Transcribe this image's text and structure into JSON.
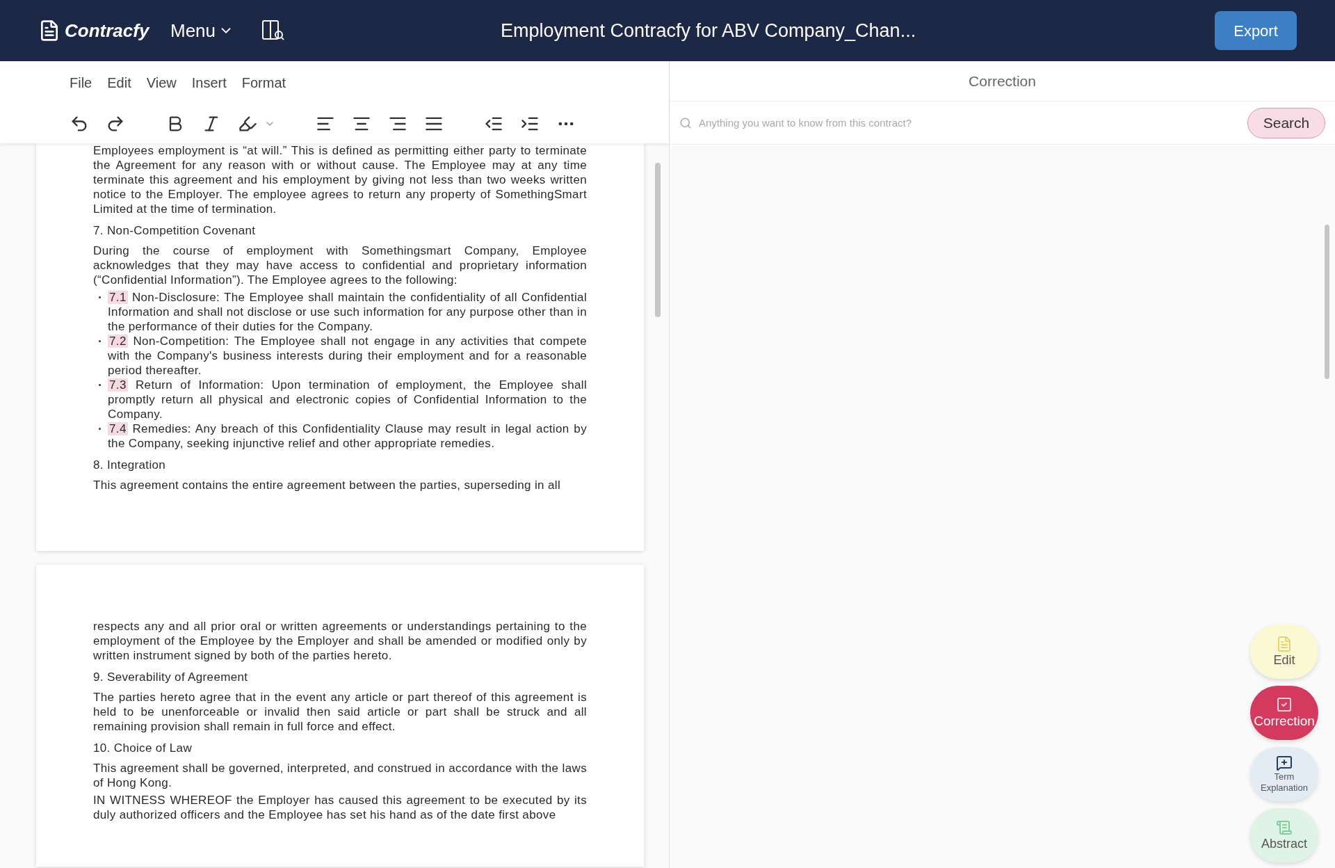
{
  "header": {
    "logo": "Contracfy",
    "menu": "Menu",
    "title": "Employment Contracfy for ABV Company_Chan...",
    "export": "Export"
  },
  "menu_bar": [
    "File",
    "Edit",
    "View",
    "Insert",
    "Format"
  ],
  "pages": [
    {
      "blocks": [
        {
          "kind": "paragraph",
          "text": "Employees employment is “at will.” This is defined as permitting either party to terminate the Agreement for any reason with or without cause. The Employee may at any time terminate this agreement and his employment by giving not less than two weeks written notice to the Employer. The employee agrees to return any property of SomethingSmart Limited at the time of termination."
        },
        {
          "kind": "heading",
          "text": "7. Non-Competition Covenant"
        },
        {
          "kind": "paragraph",
          "text": "During the course of employment with Somethingsmart Company, Employee acknowledges that they may have access to confidential and proprietary information (“Confidential Information”). The Employee agrees to the following:"
        },
        {
          "kind": "bullet",
          "number": "7.1",
          "text": "Non-Disclosure: The Employee shall maintain the confidentiality of all Confidential Information and shall not disclose or use such information for any purpose other than in the performance of their duties for the Company."
        },
        {
          "kind": "bullet",
          "number": "7.2",
          "text": "Non-Competition: The Employee shall not engage in any activities that compete with the Company's business interests during their employment and for a reasonable period thereafter."
        },
        {
          "kind": "bullet",
          "number": "7.3",
          "text": "Return of Information: Upon termination of employment, the Employee shall promptly return all physical and electronic copies of Confidential Information to the Company."
        },
        {
          "kind": "bullet",
          "number": "7.4",
          "text": "Remedies: Any breach of this Confidentiality Clause may result in legal action by the Company, seeking injunctive relief and other appropriate remedies."
        },
        {
          "kind": "heading",
          "text": "8. Integration"
        },
        {
          "kind": "paragraph",
          "text": "This agreement contains the entire agreement between the parties, superseding in all"
        }
      ]
    },
    {
      "blocks": [
        {
          "kind": "paragraph",
          "text": "respects any and all prior oral or written agreements or understandings pertaining to the employment of the Employee by the Employer and shall be amended or modified only by written instrument signed by both of the parties hereto."
        },
        {
          "kind": "heading",
          "text": "9. Severability of Agreement"
        },
        {
          "kind": "paragraph",
          "text": "The parties hereto agree that in the event any article or part thereof of this agreement is held to be unenforceable or invalid then said article or part shall be struck and all remaining provision shall remain in full force and effect."
        },
        {
          "kind": "heading",
          "text": "10. Choice of Law"
        },
        {
          "kind": "paragraph",
          "text": "This agreement shall be governed, interpreted, and construed in accordance with the laws of Hong Kong."
        },
        {
          "kind": "paragraph",
          "text": "IN WITNESS WHEREOF the Employer has caused this agreement to be executed by its duly authorized officers and the Employee has set his hand as of the date first above"
        }
      ]
    }
  ],
  "correction_panel": {
    "title": "Correction",
    "search": {
      "placeholder": "Anything you want to know from this contract?",
      "button": "Search"
    }
  },
  "side_buttons": [
    {
      "kind": "edit",
      "label": "Edit",
      "selected": false
    },
    {
      "kind": "correction",
      "label": "Correction",
      "selected": true
    },
    {
      "kind": "term",
      "label": "Term Explanation",
      "selected": false
    },
    {
      "kind": "abstract",
      "label": "Abstract",
      "selected": false
    }
  ]
}
